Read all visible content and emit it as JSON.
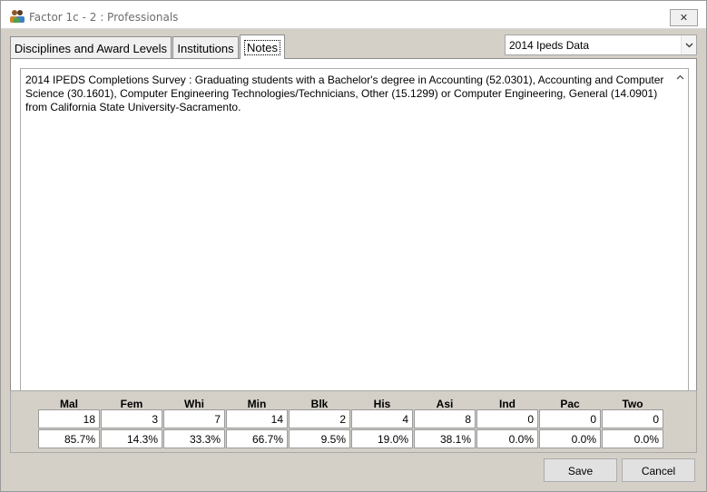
{
  "window": {
    "title": "Factor 1c - 2 : Professionals",
    "close_glyph": "✕",
    "icon": "app-people-icon"
  },
  "tabs": [
    {
      "label": "Disciplines and Award Levels",
      "active": false
    },
    {
      "label": "Institutions",
      "active": false
    },
    {
      "label": "Notes",
      "active": true
    }
  ],
  "data_source": {
    "selected": "2014 Ipeds Data"
  },
  "notes": {
    "text": "2014 IPEDS Completions Survey : Graduating students with a Bachelor's degree in Accounting (52.0301), Accounting and Computer Science (30.1601), Computer Engineering Technologies/Technicians, Other (15.1299) or Computer Engineering, General (14.0901) from California State University-Sacramento."
  },
  "stats": {
    "columns": [
      {
        "key": "mal",
        "label": "Mal",
        "count": "18",
        "pct": "85.7%"
      },
      {
        "key": "fem",
        "label": "Fem",
        "count": "3",
        "pct": "14.3%"
      },
      {
        "key": "whi",
        "label": "Whi",
        "count": "7",
        "pct": "33.3%"
      },
      {
        "key": "min",
        "label": "Min",
        "count": "14",
        "pct": "66.7%"
      },
      {
        "key": "blk",
        "label": "Blk",
        "count": "2",
        "pct": "9.5%"
      },
      {
        "key": "his",
        "label": "His",
        "count": "4",
        "pct": "19.0%"
      },
      {
        "key": "asi",
        "label": "Asi",
        "count": "8",
        "pct": "38.1%"
      },
      {
        "key": "ind",
        "label": "Ind",
        "count": "0",
        "pct": "0.0%"
      },
      {
        "key": "pac",
        "label": "Pac",
        "count": "0",
        "pct": "0.0%"
      },
      {
        "key": "two",
        "label": "Two",
        "count": "0",
        "pct": "0.0%"
      }
    ]
  },
  "buttons": {
    "save_label": "Save",
    "cancel_label": "Cancel"
  }
}
